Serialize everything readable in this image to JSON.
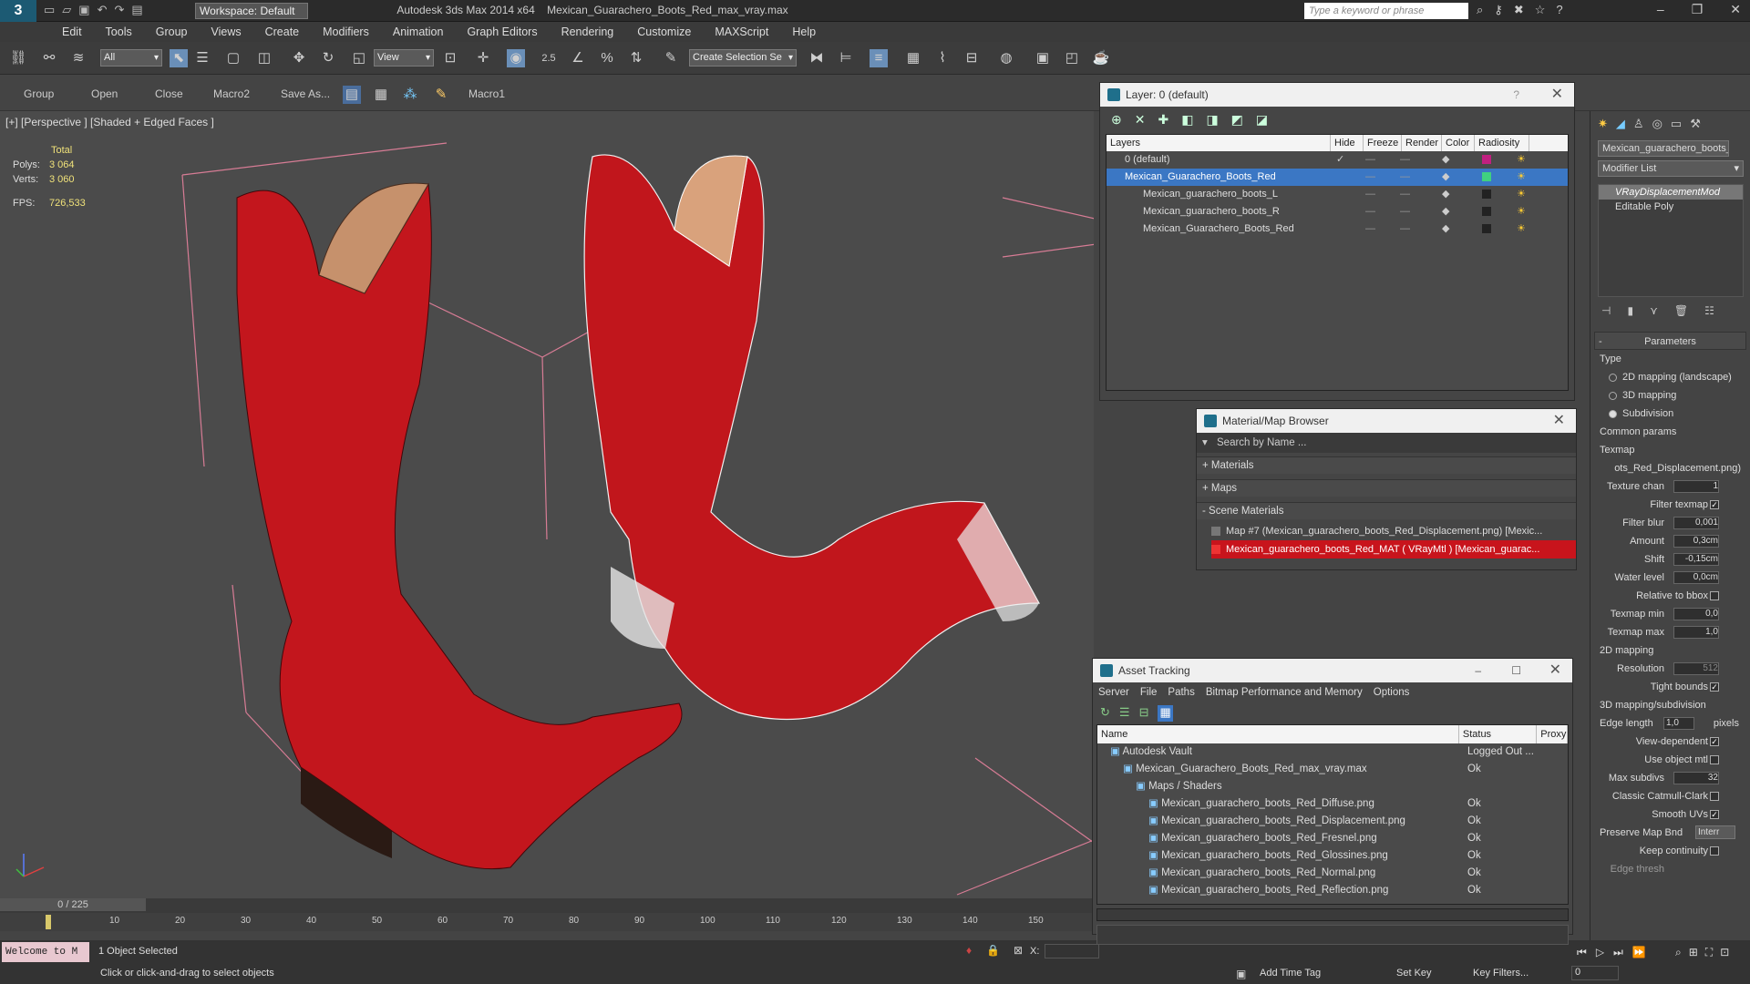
{
  "app": {
    "title": "Autodesk 3ds Max  2014 x64",
    "file": "Mexican_Guarachero_Boots_Red_max_vray.max",
    "workspace": "Workspace: Default",
    "search_placeholder": "Type a keyword or phrase",
    "logo": "3"
  },
  "menu": [
    "Edit",
    "Tools",
    "Group",
    "Views",
    "Create",
    "Modifiers",
    "Animation",
    "Graph Editors",
    "Rendering",
    "Customize",
    "MAXScript",
    "Help"
  ],
  "toolbar": {
    "filter": "All",
    "refcoord": "View",
    "selset": "Create Selection Se",
    "snap_label": "2.5"
  },
  "toolbar2": [
    "Group",
    "Open",
    "Close",
    "Macro2",
    "Save As...",
    "Macro1"
  ],
  "viewport": {
    "label": "[+] [Perspective ] [Shaded + Edged Faces ]",
    "stats_total": "Total",
    "polys_label": "Polys:",
    "polys": "3 064",
    "verts_label": "Verts:",
    "verts": "3 060",
    "fps_label": "FPS:",
    "fps": "726,533"
  },
  "timeline": {
    "frame": "0 / 225",
    "ticks": [
      "10",
      "20",
      "30",
      "40",
      "50",
      "60",
      "70",
      "80",
      "90",
      "100",
      "110",
      "120",
      "130",
      "140",
      "150"
    ]
  },
  "status": {
    "maxscript": "Welcome to M",
    "selected": "1 Object Selected",
    "prompt": "Click or click-and-drag to select objects",
    "x_label": "X:",
    "add_time_tag": "Add Time Tag",
    "set_key": "Set Key",
    "key_filters": "Key Filters...",
    "frame_val": "0"
  },
  "layer_panel": {
    "title": "Layer: 0 (default)",
    "help": "?",
    "cols": [
      "Layers",
      "Hide",
      "Freeze",
      "Render",
      "Color",
      "Radiosity"
    ],
    "rows": [
      {
        "name": "0 (default)",
        "color": "#c02080",
        "indent": 0,
        "sel": false,
        "check": "✓"
      },
      {
        "name": "Mexican_Guarachero_Boots_Red",
        "color": "#40d080",
        "indent": 0,
        "sel": true,
        "check": ""
      },
      {
        "name": "Mexican_guarachero_boots_L",
        "color": "#222222",
        "indent": 1,
        "sel": false,
        "check": ""
      },
      {
        "name": "Mexican_guarachero_boots_R",
        "color": "#222222",
        "indent": 1,
        "sel": false,
        "check": ""
      },
      {
        "name": "Mexican_Guarachero_Boots_Red",
        "color": "#222222",
        "indent": 1,
        "sel": false,
        "check": ""
      }
    ]
  },
  "material_browser": {
    "title": "Material/Map Browser",
    "search": "Search by Name ...",
    "materials": "+ Materials",
    "maps": "+ Maps",
    "scene": "- Scene Materials",
    "items": [
      "Map #7 (Mexican_guarachero_boots_Red_Displacement.png) [Mexic...",
      "Mexican_guarachero_boots_Red_MAT ( VRayMtl ) [Mexican_guarac..."
    ]
  },
  "asset_tracking": {
    "title": "Asset Tracking",
    "menu": [
      "Server",
      "File",
      "Paths",
      "Bitmap Performance and Memory",
      "Options"
    ],
    "cols": [
      "Name",
      "Status",
      "Proxy"
    ],
    "rows": [
      {
        "name": "Autodesk Vault",
        "status": "Logged Out ...",
        "indent": 1
      },
      {
        "name": "Mexican_Guarachero_Boots_Red_max_vray.max",
        "status": "Ok",
        "indent": 2
      },
      {
        "name": "Maps / Shaders",
        "status": "",
        "indent": 3
      },
      {
        "name": "Mexican_guarachero_boots_Red_Diffuse.png",
        "status": "Ok",
        "indent": 4
      },
      {
        "name": "Mexican_guarachero_boots_Red_Displacement.png",
        "status": "Ok",
        "indent": 4
      },
      {
        "name": "Mexican_guarachero_boots_Red_Fresnel.png",
        "status": "Ok",
        "indent": 4
      },
      {
        "name": "Mexican_guarachero_boots_Red_Glossines.png",
        "status": "Ok",
        "indent": 4
      },
      {
        "name": "Mexican_guarachero_boots_Red_Normal.png",
        "status": "Ok",
        "indent": 4
      },
      {
        "name": "Mexican_guarachero_boots_Red_Reflection.png",
        "status": "Ok",
        "indent": 4
      }
    ]
  },
  "command_panel": {
    "object_name": "Mexican_guarachero_boots_l",
    "modifier_list": "Modifier List",
    "stack": [
      "VRayDisplacementMod",
      "Editable Poly"
    ],
    "params_title": "Parameters",
    "type_label": "Type",
    "types": [
      "2D mapping (landscape)",
      "3D mapping",
      "Subdivision"
    ],
    "common": "Common params",
    "texmap": "Texmap",
    "texmap_val": "ots_Red_Displacement.png)",
    "fields": [
      {
        "label": "Texture chan",
        "val": "1"
      },
      {
        "label": "Filter texmap",
        "chk": "✓"
      },
      {
        "label": "Filter blur",
        "val": "0,001"
      },
      {
        "label": "Amount",
        "val": "0,3cm"
      },
      {
        "label": "Shift",
        "val": "-0,15cm"
      },
      {
        "label": "Water level",
        "val": "0,0cm"
      },
      {
        "label": "Relative to bbox",
        "chk": ""
      },
      {
        "label": "Texmap min",
        "val": "0,0"
      },
      {
        "label": "Texmap max",
        "val": "1,0"
      }
    ],
    "map2d": "2D mapping",
    "resolution_label": "Resolution",
    "resolution": "512",
    "tight": "Tight bounds",
    "map3d": "3D mapping/subdivision",
    "edge_len": "Edge length",
    "edge_val": "1,0",
    "pixels": "pixels",
    "f3": [
      {
        "label": "View-dependent",
        "chk": "✓"
      },
      {
        "label": "Use object mtl",
        "chk": ""
      },
      {
        "label": "Max subdivs",
        "val": "32"
      },
      {
        "label": "Classic Catmull-Clark",
        "chk": ""
      },
      {
        "label": "Smooth UVs",
        "chk": "✓"
      }
    ],
    "preserve": "Preserve Map Bnd",
    "preserve_val": "Interr",
    "keep": "Keep continuity",
    "edge_thresh": "Edge thresh"
  }
}
